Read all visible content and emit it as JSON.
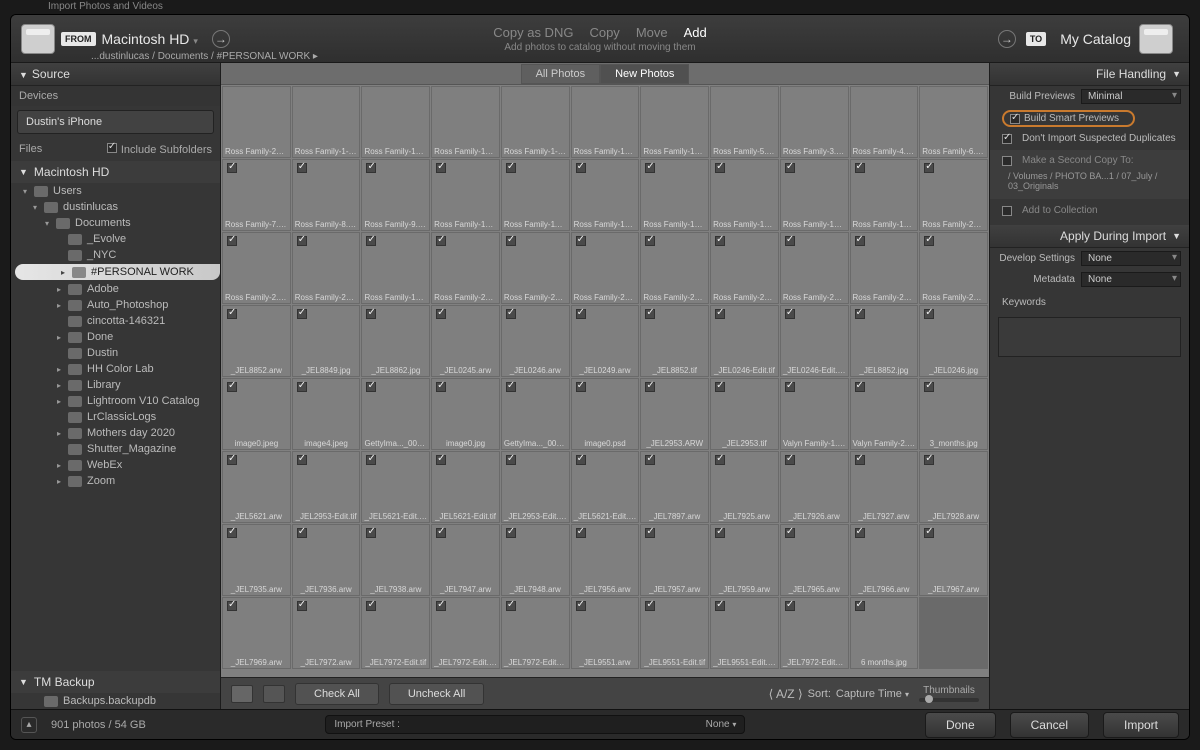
{
  "window_title": "Import Photos and Videos",
  "topbar": {
    "from_badge": "FROM",
    "to_badge": "TO",
    "source_volume": "Macintosh HD",
    "dest_catalog": "My Catalog",
    "breadcrumb": "...dustinlucas / Documents / #PERSONAL WORK ▸",
    "modes": [
      "Copy as DNG",
      "Copy",
      "Move",
      "Add"
    ],
    "mode_selected": 3,
    "subtitle": "Add photos to catalog without moving them"
  },
  "source_panel": {
    "title": "Source",
    "devices_label": "Devices",
    "device": "Dustin's iPhone",
    "files_label": "Files",
    "include_subfolders": "Include Subfolders",
    "volume": "Macintosh HD",
    "tree": [
      {
        "l": 0,
        "t": "▾",
        "n": "Users"
      },
      {
        "l": 1,
        "t": "▾",
        "n": "dustinlucas"
      },
      {
        "l": 2,
        "t": "▾",
        "n": "Documents"
      },
      {
        "l": 3,
        "t": "",
        "n": "_Evolve"
      },
      {
        "l": 3,
        "t": "",
        "n": "_NYC"
      },
      {
        "l": 3,
        "t": "▸",
        "n": "#PERSONAL WORK",
        "sel": true
      },
      {
        "l": 3,
        "t": "▸",
        "n": "Adobe"
      },
      {
        "l": 3,
        "t": "▸",
        "n": "Auto_Photoshop"
      },
      {
        "l": 3,
        "t": "",
        "n": "cincotta-146321"
      },
      {
        "l": 3,
        "t": "▸",
        "n": "Done"
      },
      {
        "l": 3,
        "t": "",
        "n": "Dustin"
      },
      {
        "l": 3,
        "t": "▸",
        "n": "HH Color Lab"
      },
      {
        "l": 3,
        "t": "▸",
        "n": "Library"
      },
      {
        "l": 3,
        "t": "▸",
        "n": "Lightroom V10 Catalog"
      },
      {
        "l": 3,
        "t": "",
        "n": "LrClassicLogs"
      },
      {
        "l": 3,
        "t": "▸",
        "n": "Mothers day 2020"
      },
      {
        "l": 3,
        "t": "",
        "n": "Shutter_Magazine"
      },
      {
        "l": 3,
        "t": "▸",
        "n": "WebEx"
      },
      {
        "l": 3,
        "t": "▸",
        "n": "Zoom"
      }
    ],
    "volume2": "TM Backup",
    "volume2_item": "Backups.backupdb"
  },
  "grid": {
    "tab_all": "All Photos",
    "tab_new": "New Photos",
    "check_all": "Check All",
    "uncheck_all": "Uncheck All",
    "sort_label": "Sort:",
    "sort_value": "Capture Time",
    "thumbs_label": "Thumbnails",
    "files": [
      "Ross Family-29.arw",
      "Ross Family-1-Edit.tif",
      "Ross Family-15-Edit.tif",
      "Ross Family-13-Edit.tif",
      "Ross Family-1-Edit.jpg",
      "Ross Family-13-Edit.jpg",
      "Ross Family-15-Edit.jpg",
      "Ross Family-5.jpg",
      "Ross Family-3.jpg",
      "Ross Family-4.jpg",
      "Ross Family-6.jpg",
      "Ross Family-7.jpg",
      "Ross Family-8.jpg",
      "Ross Family-9.jpg",
      "Ross Family-10.jpg",
      "Ross Family-11.jpg",
      "Ross Family-12.jpg",
      "Ross Family-13.jpg",
      "Ross Family-17.jpg",
      "Ross Family-18.jpg",
      "Ross Family-19.jpg",
      "Ross Family-20.jpg",
      "Ross Family-2.jpg",
      "Ross Family-21.jpg",
      "Ross Family-14.jpg",
      "Ross Family-22.jpg",
      "Ross Family-23.jpg",
      "Ross Family-24.jpg",
      "Ross Family-25.jpg",
      "Ross Family-26.jpg",
      "Ross Family-27.jpg",
      "Ross Family-28.jpg",
      "Ross Family-29.jpg",
      "_JEL8852.arw",
      "_JEL8849.jpg",
      "_JEL8862.jpg",
      "_JEL0245.arw",
      "_JEL0246.arw",
      "_JEL0249.arw",
      "_JEL8852.tif",
      "_JEL0246-Edit.tif",
      "_JEL0246-Edit.jpg",
      "_JEL8852.jpg",
      "_JEL0246.jpg",
      "image0.jpeg",
      "image4.jpeg",
      "GettyIma..._00894.jpg",
      "image0.jpg",
      "GettyIma..._00894.jpg",
      "image0.psd",
      "_JEL2953.ARW",
      "_JEL2953.tif",
      "Valyn Family-1.jpg",
      "Valyn Family-2.jpg",
      "3_months.jpg",
      "_JEL5621.arw",
      "_JEL2953-Edit.tif",
      "_JEL5621-Edit.jpg",
      "_JEL5621-Edit.tif",
      "_JEL2953-Edit.jpg",
      "_JEL5621-Edit.jpg",
      "_JEL7897.arw",
      "_JEL7925.arw",
      "_JEL7926.arw",
      "_JEL7927.arw",
      "_JEL7928.arw",
      "_JEL7935.arw",
      "_JEL7936.arw",
      "_JEL7938.arw",
      "_JEL7947.arw",
      "_JEL7948.arw",
      "_JEL7956.arw",
      "_JEL7957.arw",
      "_JEL7959.arw",
      "_JEL7965.arw",
      "_JEL7966.arw",
      "_JEL7967.arw",
      "_JEL7969.arw",
      "_JEL7972.arw",
      "_JEL7972-Edit.tif",
      "_JEL7972-Edit.jpg",
      "_JEL7972-Edit_1.jpg",
      "_JEL9551.arw",
      "_JEL9551-Edit.tif",
      "_JEL9551-Edit.jpg",
      "_JEL7972-Edit_2.jpg",
      "6 months.jpg",
      ""
    ]
  },
  "right": {
    "file_handling_title": "File Handling",
    "build_previews_label": "Build Previews",
    "build_previews_value": "Minimal",
    "smart_previews": "Build Smart Previews",
    "no_dupes": "Don't Import Suspected Duplicates",
    "second_copy": "Make a Second Copy To:",
    "second_copy_path": "/ Volumes / PHOTO BA...1 / 07_July / 03_Originals",
    "add_collection": "Add to Collection",
    "apply_title": "Apply During Import",
    "develop_label": "Develop Settings",
    "develop_value": "None",
    "metadata_label": "Metadata",
    "metadata_value": "None",
    "keywords_label": "Keywords"
  },
  "footer": {
    "status": "901 photos / 54 GB",
    "preset_label": "Import Preset :",
    "preset_value": "None",
    "btn_done": "Done",
    "btn_cancel": "Cancel",
    "btn_import": "Import"
  }
}
